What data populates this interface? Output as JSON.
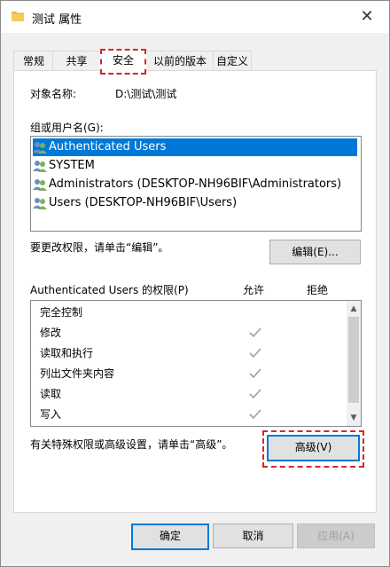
{
  "window": {
    "title": "测试 属性",
    "close_icon": "close-icon",
    "folder_icon": "folder-icon"
  },
  "tabs": [
    {
      "label": "常规"
    },
    {
      "label": "共享"
    },
    {
      "label": "安全",
      "active": true
    },
    {
      "label": "以前的版本"
    },
    {
      "label": "自定义"
    }
  ],
  "object": {
    "label": "对象名称:",
    "value": "D:\\测试\\测试"
  },
  "groups": {
    "label": "组或用户名(G):",
    "items": [
      {
        "name": "Authenticated Users",
        "icon": "users-icon",
        "selected": true
      },
      {
        "name": "SYSTEM",
        "icon": "users-icon"
      },
      {
        "name": "Administrators (DESKTOP-NH96BIF\\Administrators)",
        "icon": "users-icon"
      },
      {
        "name": "Users (DESKTOP-NH96BIF\\Users)",
        "icon": "users-icon"
      }
    ]
  },
  "edit": {
    "hint": "要更改权限，请单击“编辑”。",
    "button_label": "编辑(E)..."
  },
  "permissions": {
    "header_label": "Authenticated Users 的权限(P)",
    "allow_label": "允许",
    "deny_label": "拒绝",
    "rows": [
      {
        "name": "完全控制",
        "allow": false,
        "deny": false
      },
      {
        "name": "修改",
        "allow": true,
        "deny": false
      },
      {
        "name": "读取和执行",
        "allow": true,
        "deny": false
      },
      {
        "name": "列出文件夹内容",
        "allow": true,
        "deny": false
      },
      {
        "name": "读取",
        "allow": true,
        "deny": false
      },
      {
        "name": "写入",
        "allow": true,
        "deny": false
      }
    ],
    "scroll_position": 0.0
  },
  "advanced": {
    "hint": "有关特殊权限或高级设置，请单击“高级”。",
    "button_label": "高级(V)"
  },
  "footer": {
    "ok_label": "确定",
    "cancel_label": "取消",
    "apply_label": "应用(A)"
  },
  "colors": {
    "highlight": "#d7262b",
    "selection": "#0078d7",
    "check": "#a0a0a0"
  }
}
